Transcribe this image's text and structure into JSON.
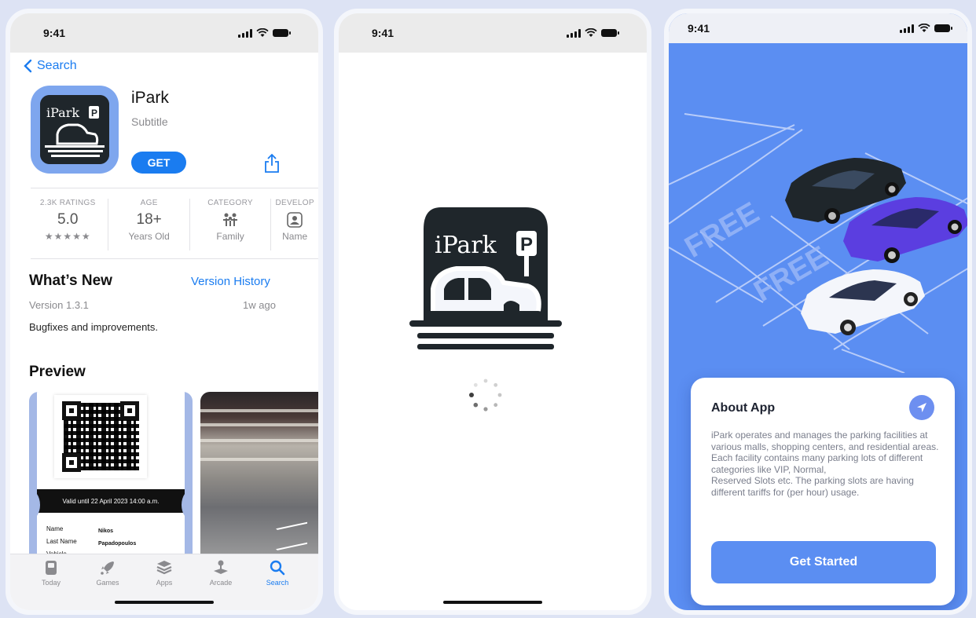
{
  "screens": [
    {
      "status": {
        "time": "9:41"
      },
      "nav": {
        "back_label": "Search"
      },
      "app": {
        "name": "iPark",
        "subtitle": "Subtitle",
        "get_label": "GET"
      },
      "stats": [
        {
          "label": "2.3K RATINGS",
          "value": "5.0",
          "sub": "★★★★★"
        },
        {
          "label": "AGE",
          "value": "18+",
          "sub": "Years Old"
        },
        {
          "label": "CATEGORY",
          "value": "",
          "sub": "Family"
        },
        {
          "label": "DEVELOP",
          "value": "",
          "sub": "Name"
        }
      ],
      "whats_new": {
        "title": "What’s New",
        "history_link": "Version History",
        "version": "Version 1.3.1",
        "ago": "1w ago",
        "notes": "Bugfixes and improvements."
      },
      "preview": {
        "title": "Preview",
        "ticket": {
          "valid_until": "Valid until 22 April 2023 14:00 a.m.",
          "rows": [
            {
              "label": "Name",
              "value": "Nikos"
            },
            {
              "label": "Last Name",
              "value": "Papadopoulos"
            },
            {
              "label": "Vehicle",
              "value": ""
            }
          ]
        }
      },
      "tabs": [
        {
          "label": "Today",
          "icon": "today-icon"
        },
        {
          "label": "Games",
          "icon": "rocket-icon"
        },
        {
          "label": "Apps",
          "icon": "stack-icon"
        },
        {
          "label": "Arcade",
          "icon": "joystick-icon"
        },
        {
          "label": "Search",
          "icon": "search-icon",
          "active": true
        }
      ]
    },
    {
      "status": {
        "time": "9:41"
      },
      "logo_text": "iPark",
      "logo_badge": "P"
    },
    {
      "status": {
        "time": "9:41"
      },
      "scene_labels": [
        "FREE",
        "FREE"
      ],
      "about": {
        "title": "About App",
        "text": "iPark operates and manages the parking facilities at various malls, shopping centers, and residential areas. Each facility contains many parking lots of different categories like VIP, Normal,\nReserved Slots etc. The parking slots are having different tariffs for (per hour) usage.",
        "button": "Get Started"
      }
    }
  ],
  "colors": {
    "ios_blue": "#1a7cf0",
    "brand_blue": "#5b8ef2",
    "icon_dark": "#1f262b"
  }
}
